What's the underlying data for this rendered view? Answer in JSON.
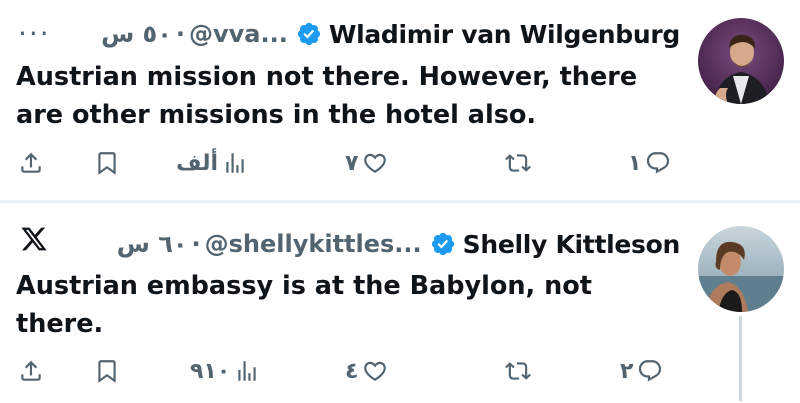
{
  "tweets": [
    {
      "name": "Wladimir van Wilgenburg",
      "handle": "@vva...",
      "time": "٥٠ س",
      "text": "Austrian mission not there. However, there are other missions in the hotel also.",
      "more_icon": "···",
      "views": "ألف",
      "likes": "٧",
      "retweets": "",
      "replies": "١"
    },
    {
      "name": "Shelly Kittleson",
      "handle": "@shellykittles...",
      "time": "٦٠ س",
      "text": "Austrian embassy is at the Babylon, not there.",
      "views": "٩١٠",
      "likes": "٤",
      "retweets": "",
      "replies": "٢"
    }
  ],
  "icons": [
    "more-icon",
    "x-logo-icon",
    "verified-badge-icon",
    "share-icon",
    "bookmark-icon",
    "views-icon",
    "like-icon",
    "retweet-icon",
    "reply-icon"
  ],
  "colors": {
    "verified": "#1d9bf0",
    "muted": "#536471",
    "text": "#0f1419"
  }
}
